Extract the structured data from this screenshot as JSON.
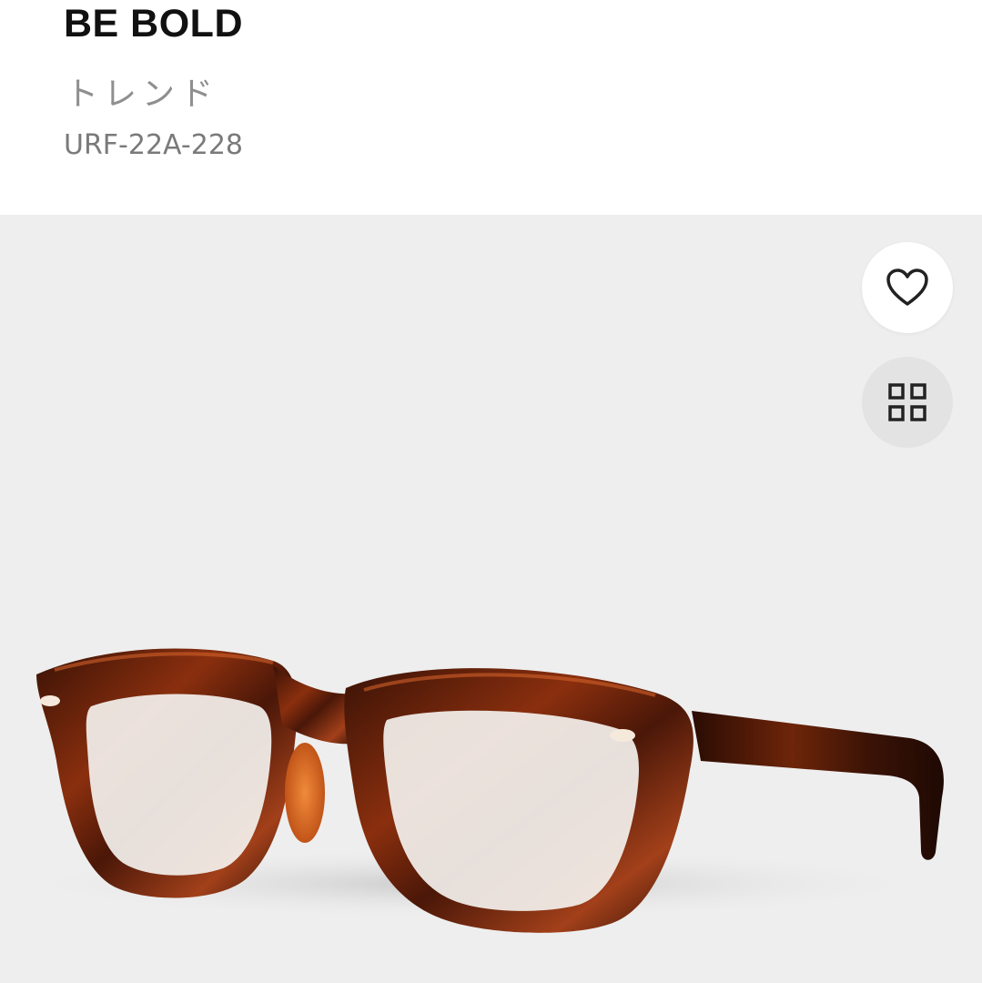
{
  "header": {
    "brand": "BE BOLD",
    "category": "トレンド",
    "model_code": "URF-22A-228"
  },
  "product_image": {
    "subject": "tortoiseshell-glasses",
    "background_color": "#eeeeee",
    "frame_color": "#7a2a0c"
  },
  "actions": {
    "favorite_icon": "heart-icon",
    "grid_icon": "grid-icon"
  }
}
